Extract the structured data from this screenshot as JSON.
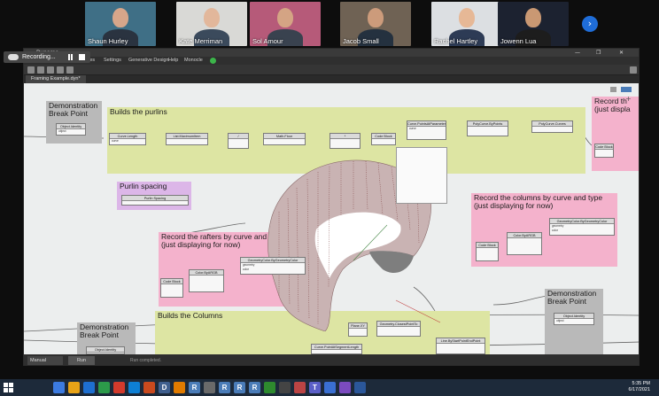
{
  "participants": [
    {
      "name": "Shaun Hurley",
      "bg": "#3f6f86",
      "skin": "#d7a68a",
      "shirt": "#2a3340"
    },
    {
      "name": "Kate Merriman",
      "bg": "#d9d9d6",
      "skin": "#e2b79b",
      "shirt": "#3b4a5c"
    },
    {
      "name": "Sol Amour",
      "bg": "#b65a79",
      "skin": "#d4a484",
      "shirt": "#39424f"
    },
    {
      "name": "Jacob Small",
      "bg": "#6f6254",
      "skin": "#cc9b7b",
      "shirt": "#24313f"
    },
    {
      "name": "Rachel Hartley",
      "bg": "#dcdfe2",
      "skin": "#e6b896",
      "shirt": "#2d3b55"
    },
    {
      "name": "Jowenn Lua",
      "bg": "#1c2230",
      "skin": "#c99873",
      "shirt": "#1d1d1d"
    }
  ],
  "recording": {
    "label": "Recording..."
  },
  "app": {
    "title": "Dynamo",
    "menu": [
      "File",
      "Edit",
      "View",
      "Packages",
      "Settings",
      "Generative Design",
      "Help",
      "Monocle"
    ],
    "tab": "Framing Example.dyn*",
    "window_controls": [
      "—",
      "❐",
      "✕"
    ]
  },
  "groups": {
    "break_point_1": "Demonstration\nBreak Point",
    "purlins": "Builds the purlins",
    "purlin_spacing": "Purlin spacing",
    "rafters": "Record the rafters by curve and type\n(just displaying for now)",
    "columns_record": "Record the columns by curve and type\n(just displaying for now)",
    "record_right": "Record th\n(just displa",
    "break_point_2": "Demonstration\nBreak Point",
    "break_point_3": "Demonstration\nBreak Point",
    "builds_columns": "Builds the Columns"
  },
  "nodes": {
    "object_identity": "Object.Identity",
    "curve_length": "Curve.Length",
    "list_maximum": "List.MaximumItem",
    "divide": "/",
    "math_floor": "Math.Floor",
    "multiply": "*",
    "code_block": "Code Block",
    "curve_points": "Curve.PointsAtParameter",
    "polycurve": "PolyCurve.ByPoints",
    "polycurve_curves": "PolyCurve.Curves",
    "purlin_slider": "Purlin Spacing",
    "geom_color": "GeometryColor.ByGeometryColor",
    "color_argb": "Color.ByARGB",
    "geometry_closest": "Geometry.ClosestPointTo",
    "line_by_points": "Line.ByStartPointEndPoint",
    "curve_point_at": "Curve.PointAtSegmentLength",
    "plane_xy": "Plane.XY",
    "port_geometry": "geometry",
    "port_color": "color",
    "port_curve": "curve",
    "port_object": "object"
  },
  "status": {
    "run_mode": "Manual",
    "run_button": "Run",
    "message": "Run completed."
  },
  "taskbar": {
    "time": "5:35 PM",
    "date": "6/17/2021",
    "apps": [
      {
        "letter": "",
        "color": "#3c7be0"
      },
      {
        "letter": "",
        "color": "#e8a317"
      },
      {
        "letter": "",
        "color": "#1e6fd0"
      },
      {
        "letter": "",
        "color": "#2c9a4a"
      },
      {
        "letter": "",
        "color": "#d33a2c"
      },
      {
        "letter": "",
        "color": "#0d7fd4"
      },
      {
        "letter": "",
        "color": "#c94a1e"
      },
      {
        "letter": "D",
        "color": "#3f5f8e"
      },
      {
        "letter": "",
        "color": "#e07b00"
      },
      {
        "letter": "R",
        "color": "#4a7cb8"
      },
      {
        "letter": "",
        "color": "#6a6a6a"
      },
      {
        "letter": "R",
        "color": "#4a7cb8"
      },
      {
        "letter": "R",
        "color": "#4a7cb8"
      },
      {
        "letter": "R",
        "color": "#4a7cb8"
      },
      {
        "letter": "",
        "color": "#2e8a2e"
      },
      {
        "letter": "",
        "color": "#444"
      },
      {
        "letter": "",
        "color": "#b44"
      },
      {
        "letter": "T",
        "color": "#5b5fc7"
      },
      {
        "letter": "",
        "color": "#3a6fd1"
      },
      {
        "letter": "",
        "color": "#7b4bbf"
      },
      {
        "letter": "",
        "color": "#2b579a"
      }
    ]
  }
}
